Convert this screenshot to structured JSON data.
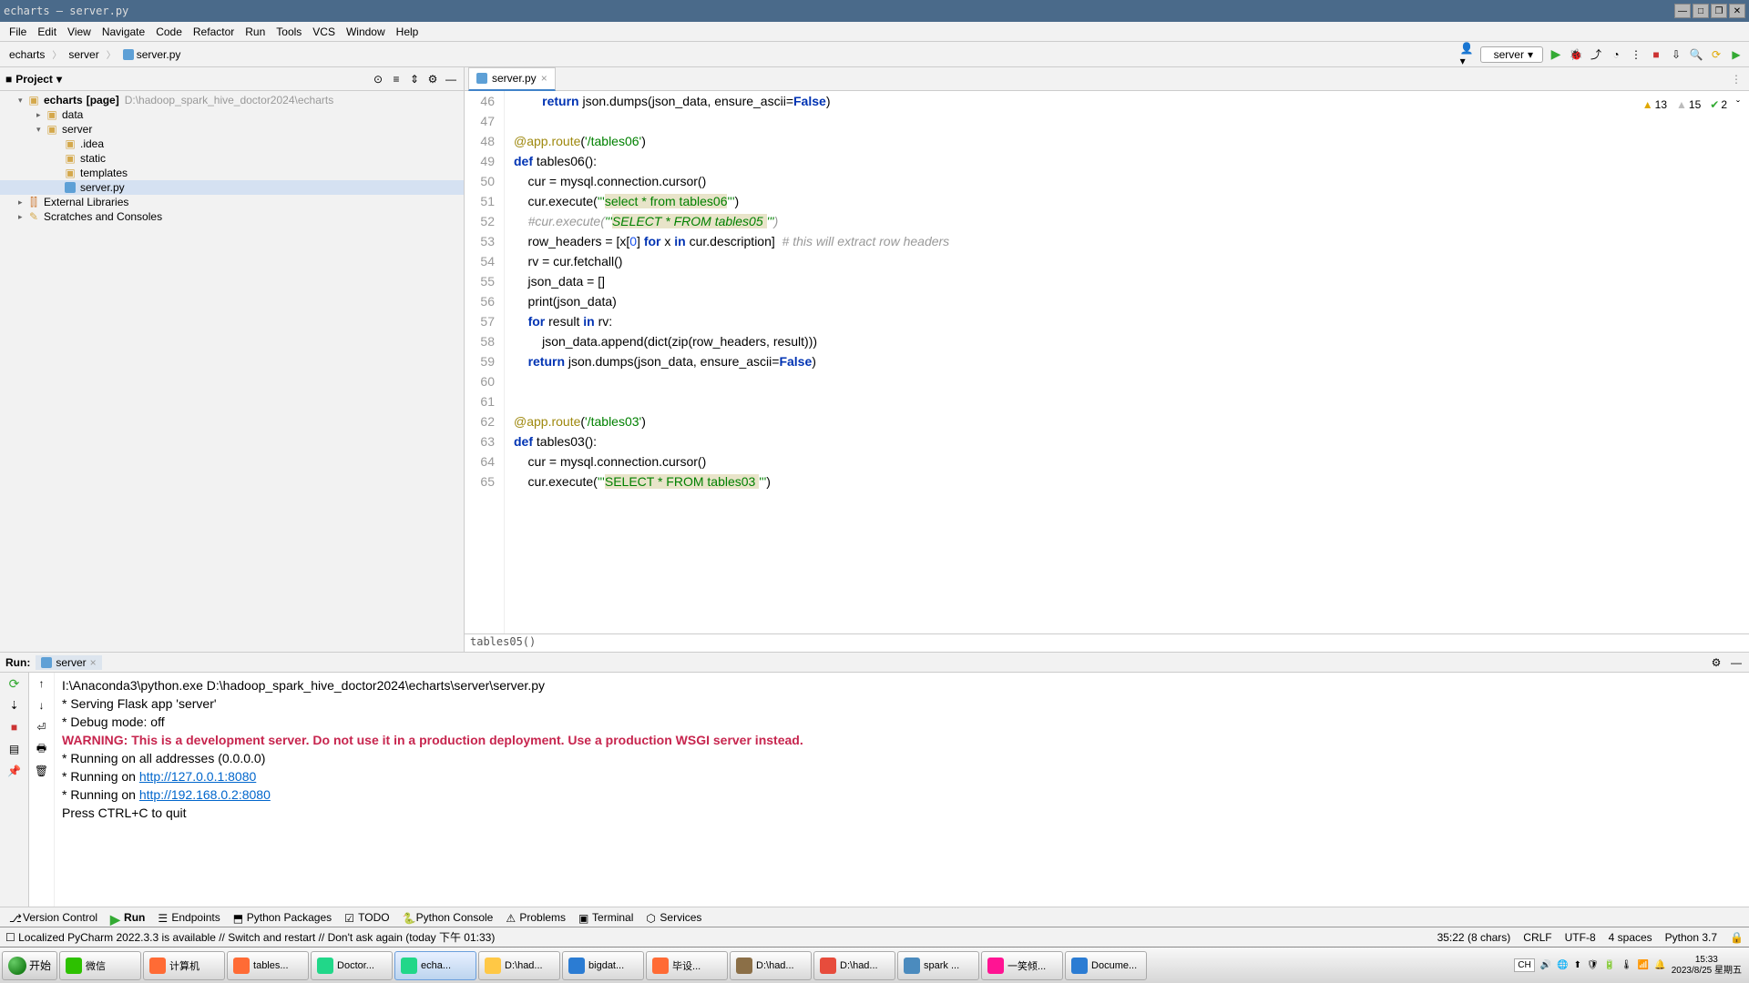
{
  "title": "echarts – server.py",
  "menu": [
    "File",
    "Edit",
    "View",
    "Navigate",
    "Code",
    "Refactor",
    "Run",
    "Tools",
    "VCS",
    "Window",
    "Help"
  ],
  "breadcrumb": {
    "root": "echarts",
    "mid": "server",
    "file": "server.py"
  },
  "runconfig": {
    "name": "server"
  },
  "projectHeader": "Project",
  "tree": {
    "root": {
      "name": "echarts",
      "tag": "[page]",
      "path": "D:\\hadoop_spark_hive_doctor2024\\echarts"
    },
    "data": "data",
    "server": "server",
    "idea": ".idea",
    "static": "static",
    "templates": "templates",
    "serverpy": "server.py",
    "extlib": "External Libraries",
    "scratches": "Scratches and Consoles"
  },
  "editorTab": "server.py",
  "inspections": {
    "warn": "13",
    "weak": "15",
    "ok": "2"
  },
  "gutterStart": 46,
  "code": [
    "        return json.dumps(json_data, ensure_ascii=False)",
    "",
    "@app.route('/tables06')",
    "def tables06():",
    "    cur = mysql.connection.cursor()",
    "    cur.execute('''select * from tables06''')",
    "    #cur.execute('''SELECT * FROM tables05 ''')",
    "    row_headers = [x[0] for x in cur.description]  # this will extract row headers",
    "    rv = cur.fetchall()",
    "    json_data = []",
    "    print(json_data)",
    "    for result in rv:",
    "        json_data.append(dict(zip(row_headers, result)))",
    "    return json.dumps(json_data, ensure_ascii=False)",
    "",
    "",
    "@app.route('/tables03')",
    "def tables03():",
    "    cur = mysql.connection.cursor()",
    "    cur.execute('''SELECT * FROM tables03 ''')"
  ],
  "editorBreadcrumb": "tables05()",
  "run": {
    "label": "Run:",
    "tab": "server",
    "lines": {
      "exe": "I:\\Anaconda3\\python.exe D:\\hadoop_spark_hive_doctor2024\\echarts\\server\\server.py",
      "l1": " * Serving Flask app 'server'",
      "l2": " * Debug mode: off",
      "warn": "WARNING: This is a development server. Do not use it in a production deployment. Use a production WSGI server instead.",
      "l3": " * Running on all addresses (0.0.0.0)",
      "l4a": " * Running on ",
      "l4b": "http://127.0.0.1:8080",
      "l5a": " * Running on ",
      "l5b": "http://192.168.0.2:8080",
      "l6": "Press CTRL+C to quit"
    }
  },
  "tooltabs": [
    "Version Control",
    "Run",
    "Endpoints",
    "Python Packages",
    "TODO",
    "Python Console",
    "Problems",
    "Terminal",
    "Services"
  ],
  "statusbar": {
    "left": "☐ Localized PyCharm 2022.3.3 is available // Switch and restart // Don't ask again (today 下午 01:33)",
    "pos": "35:22 (8 chars)",
    "eol": "CRLF",
    "enc": "UTF-8",
    "indent": "4 spaces",
    "py": "Python 3.7"
  },
  "taskbar": {
    "start": "开始",
    "items": [
      {
        "label": "微信",
        "color": "#2dc100"
      },
      {
        "label": "计算机",
        "color": "#ff6b35"
      },
      {
        "label": "tables...",
        "color": "#ff6b35"
      },
      {
        "label": "Doctor...",
        "color": "#21d789"
      },
      {
        "label": "echa...",
        "color": "#21d789",
        "active": true
      },
      {
        "label": "D:\\had...",
        "color": "#ffc845"
      },
      {
        "label": "bigdat...",
        "color": "#2b7cd3"
      },
      {
        "label": "毕设...",
        "color": "#ff6b35"
      },
      {
        "label": "D:\\had...",
        "color": "#8b6f47"
      },
      {
        "label": "D:\\had...",
        "color": "#e74c3c"
      },
      {
        "label": "spark ...",
        "color": "#4b8bbe"
      },
      {
        "label": "一笑倾...",
        "color": "#ff1493"
      },
      {
        "label": "Docume...",
        "color": "#2b7cd3"
      }
    ],
    "time": "15:33",
    "date": "2023/8/25 星期五",
    "ime": "CH"
  }
}
